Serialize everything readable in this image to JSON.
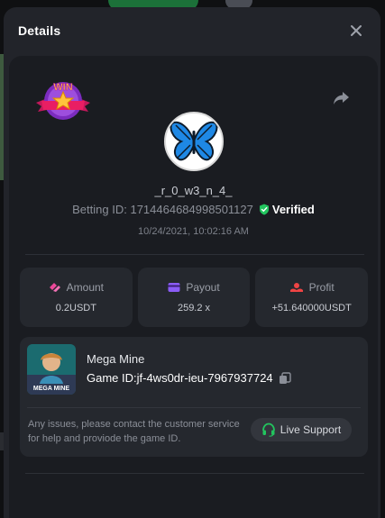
{
  "modal": {
    "title": "Details"
  },
  "details": {
    "username": "_r_0_w3_n_4_",
    "betting_id_label": "Betting ID:",
    "betting_id": "1714464684998501127",
    "verified_label": "Verified",
    "date": "10/24/2021, 10:02:16 AM",
    "win_badge_text": "WIN"
  },
  "stats": {
    "amount": {
      "label": "Amount",
      "value": "0.2USDT"
    },
    "payout": {
      "label": "Payout",
      "value": "259.2 x"
    },
    "profit": {
      "label": "Profit",
      "value": "+51.640000USDT"
    }
  },
  "game": {
    "name": "Mega Mine",
    "id": "Game ID:jf-4ws0dr-ieu-7967937724",
    "thumb_text": "MEGA MINE"
  },
  "support": {
    "message": "Any issues, please contact the customer service for help and proviode the game ID.",
    "button_label": "Live Support"
  },
  "colors": {
    "verified": "#22c55e",
    "amount_icon": "#ec4899",
    "payout_icon": "#8b5cf6",
    "profit_icon": "#ef4444",
    "support_icon": "#22c55e"
  }
}
